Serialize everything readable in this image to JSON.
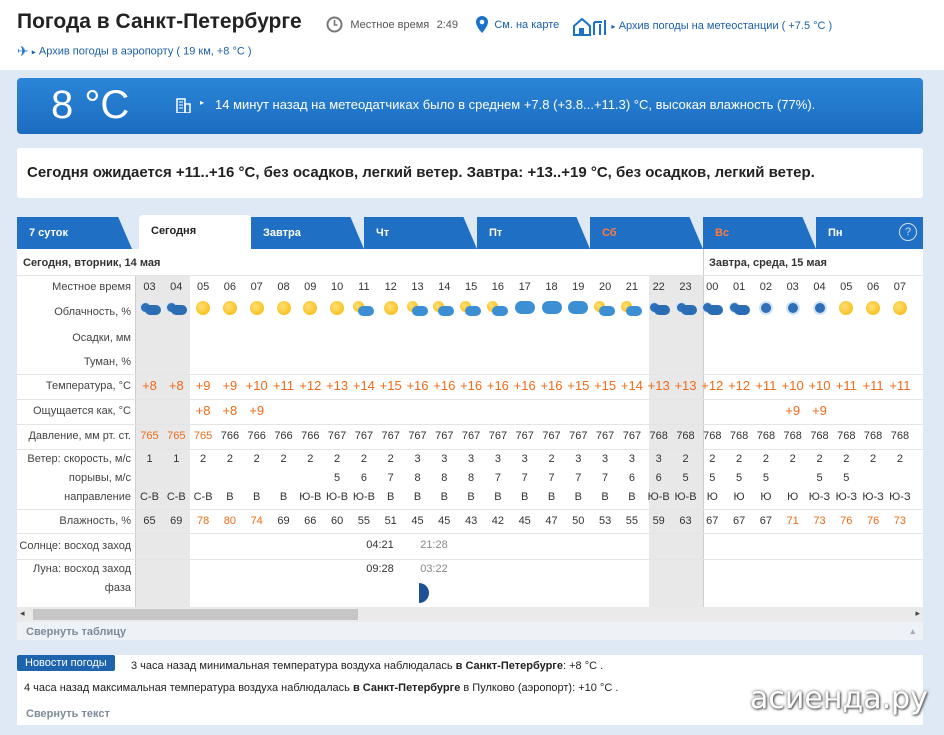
{
  "header": {
    "title": "Погода в Санкт-Петербурге",
    "local_time_label": "Местное время",
    "local_time": "2:49",
    "map_link": "См. на карте",
    "archive_station": "Архив погоды на метеостанции ( +7.5 °C )",
    "archive_airport": "Архив погоды в аэропорту ( 19 км, +8 °C )"
  },
  "current": {
    "temp": "8 °C",
    "text": "14 минут назад на метеодатчиках было в среднем +7.8 (+3.8...+11.3) °C, высокая влажность (77%)."
  },
  "forecast_text": "Сегодня ожидается +11..+16 °C, без осадков, легкий ветер. Завтра: +13..+19 °C, без осадков, легкий ветер.",
  "tabs": [
    "7 суток",
    "Сегодня",
    "Завтра",
    "Чт",
    "Пт",
    "Сб",
    "Вс",
    "Пн"
  ],
  "help": "?",
  "table": {
    "day1": "Сегодня, вторник, 14 мая",
    "day2": "Завтра, среда, 15 мая",
    "labels": {
      "time": "Местное время",
      "cloud": "Облачность, %",
      "precip": "Осадки, мм",
      "fog": "Туман, %",
      "temp": "Температура, °С",
      "feels": "Ощущается как, °С",
      "pressure": "Давление, мм рт. ст.",
      "wind": "Ветер: скорость, м/с",
      "gust": "порывы, м/с",
      "dir": "направление",
      "humid": "Влажность, %",
      "sun": "Солнце: восход заход",
      "moon": "Луна: восход заход",
      "phase": "фаза"
    },
    "hours": [
      "03",
      "04",
      "05",
      "06",
      "07",
      "08",
      "09",
      "10",
      "11",
      "12",
      "13",
      "14",
      "15",
      "16",
      "17",
      "18",
      "19",
      "20",
      "21",
      "22",
      "23",
      "00",
      "01",
      "02",
      "03",
      "04",
      "05",
      "06",
      "07"
    ],
    "clouds": [
      "night-cloud",
      "night-cloud",
      "sun",
      "sun",
      "sun",
      "sun",
      "sun",
      "sun",
      "sun-cloud",
      "sun",
      "sun-cloud",
      "sun-cloud",
      "sun-cloud",
      "sun-cloud",
      "cloud",
      "cloud",
      "cloud",
      "sun-cloud",
      "sun-cloud",
      "night-cloud",
      "night-cloud",
      "night-cloud",
      "night-cloud",
      "moon",
      "moon",
      "moon",
      "sun",
      "sun",
      "sun"
    ],
    "temp": [
      "+8",
      "+8",
      "+9",
      "+9",
      "+10",
      "+11",
      "+12",
      "+13",
      "+14",
      "+15",
      "+16",
      "+16",
      "+16",
      "+16",
      "+16",
      "+16",
      "+15",
      "+15",
      "+14",
      "+13",
      "+13",
      "+12",
      "+12",
      "+11",
      "+10",
      "+10",
      "+11",
      "+11",
      "+11"
    ],
    "feels": [
      "",
      "",
      "+8",
      "+8",
      "+9",
      "",
      "",
      "",
      "",
      "",
      "",
      "",
      "",
      "",
      "",
      "",
      "",
      "",
      "",
      "",
      "",
      "",
      "",
      "",
      "+9",
      "+9",
      "",
      "",
      ""
    ],
    "pressure": [
      "765",
      "765",
      "765",
      "766",
      "766",
      "766",
      "766",
      "767",
      "767",
      "767",
      "767",
      "767",
      "767",
      "767",
      "767",
      "767",
      "767",
      "767",
      "767",
      "768",
      "768",
      "768",
      "768",
      "768",
      "768",
      "768",
      "768",
      "768",
      "768"
    ],
    "wind": [
      "1",
      "1",
      "2",
      "2",
      "2",
      "2",
      "2",
      "2",
      "2",
      "2",
      "3",
      "3",
      "3",
      "3",
      "3",
      "2",
      "3",
      "3",
      "3",
      "3",
      "2",
      "2",
      "2",
      "2",
      "2",
      "2",
      "2",
      "2",
      "2"
    ],
    "gust": [
      "",
      "",
      "",
      "",
      "",
      "",
      "",
      "5",
      "6",
      "7",
      "8",
      "8",
      "8",
      "7",
      "7",
      "7",
      "7",
      "7",
      "6",
      "6",
      "5",
      "5",
      "5",
      "5",
      "",
      "5",
      "5",
      "",
      ""
    ],
    "dir": [
      "С-В",
      "С-В",
      "С-В",
      "В",
      "В",
      "В",
      "Ю-В",
      "Ю-В",
      "Ю-В",
      "В",
      "В",
      "В",
      "В",
      "В",
      "В",
      "В",
      "В",
      "В",
      "В",
      "Ю-В",
      "Ю-В",
      "Ю",
      "Ю",
      "Ю",
      "Ю",
      "Ю-З",
      "Ю-З",
      "Ю-З",
      "Ю-З"
    ],
    "humid": [
      "65",
      "69",
      "78",
      "80",
      "74",
      "69",
      "66",
      "60",
      "55",
      "51",
      "45",
      "45",
      "43",
      "42",
      "45",
      "47",
      "50",
      "53",
      "55",
      "59",
      "63",
      "67",
      "67",
      "67",
      "71",
      "73",
      "76",
      "76",
      "73"
    ],
    "sunrise": "04:21",
    "sunset": "21:28",
    "moonrise": "09:28",
    "moonset": "03:22"
  },
  "collapse_table": "Свернуть таблицу",
  "news": {
    "label": "Новости погоды",
    "line1_pre": "3 часа назад минимальная температура воздуха наблюдалась ",
    "line1_city": "в Санкт-Петербурге",
    "line1_post": ": +8 °C .",
    "line2_pre": "4 часа назад максимальная температура воздуха наблюдалась ",
    "line2_city": "в Санкт-Петербурге",
    "line2_post": " в Пулково (аэропорт): +10 °C .",
    "collapse": "Свернуть текст"
  },
  "watermark": "асиенда.ру",
  "colors": {
    "brand": "#1f6fc4",
    "temp": "#f06a17"
  }
}
